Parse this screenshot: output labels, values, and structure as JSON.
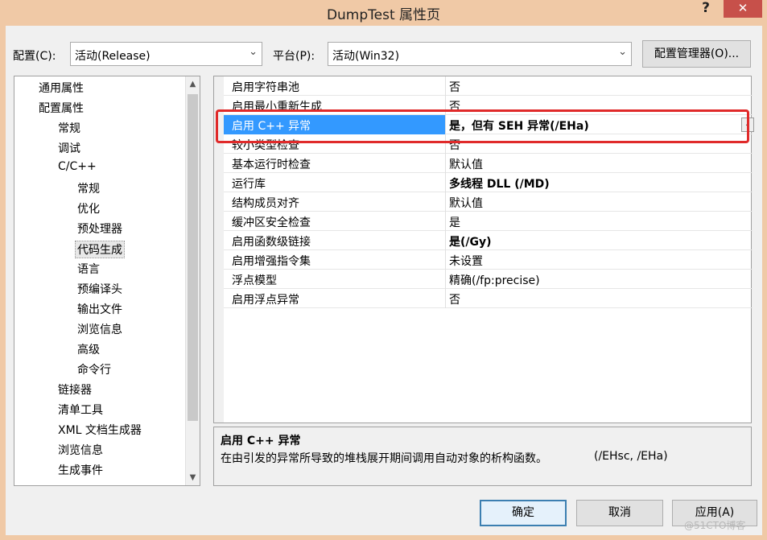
{
  "window": {
    "title": "DumpTest 属性页",
    "help": "?",
    "close": "✕"
  },
  "toolbar": {
    "config_label": "配置(C):",
    "config_value": "活动(Release)",
    "platform_label": "平台(P):",
    "platform_value": "活动(Win32)",
    "config_manager": "配置管理器(O)..."
  },
  "tree": {
    "items": [
      {
        "label": "通用属性",
        "level": 0
      },
      {
        "label": "配置属性",
        "level": 0
      },
      {
        "label": "常规",
        "level": 1
      },
      {
        "label": "调试",
        "level": 1
      },
      {
        "label": "C/C++",
        "level": 1
      },
      {
        "label": "常规",
        "level": 2
      },
      {
        "label": "优化",
        "level": 2
      },
      {
        "label": "预处理器",
        "level": 2
      },
      {
        "label": "代码生成",
        "level": 2,
        "selected": true
      },
      {
        "label": "语言",
        "level": 2
      },
      {
        "label": "预编译头",
        "level": 2
      },
      {
        "label": "输出文件",
        "level": 2
      },
      {
        "label": "浏览信息",
        "level": 2
      },
      {
        "label": "高级",
        "level": 2
      },
      {
        "label": "命令行",
        "level": 2
      },
      {
        "label": "链接器",
        "level": 1
      },
      {
        "label": "清单工具",
        "level": 1
      },
      {
        "label": "XML 文档生成器",
        "level": 1
      },
      {
        "label": "浏览信息",
        "level": 1
      },
      {
        "label": "生成事件",
        "level": 1
      }
    ]
  },
  "grid": {
    "rows": [
      {
        "name": "启用字符串池",
        "value": "否"
      },
      {
        "name": "启用最小重新生成",
        "value": "否"
      },
      {
        "name": "启用 C++ 异常",
        "value": "是，但有 SEH 异常(/EHa)",
        "selected": true
      },
      {
        "name": "较小类型检查",
        "value": "否"
      },
      {
        "name": "基本运行时检查",
        "value": "默认值"
      },
      {
        "name": "运行库",
        "value": "多线程 DLL (/MD)",
        "bold": true
      },
      {
        "name": "结构成员对齐",
        "value": "默认值"
      },
      {
        "name": "缓冲区安全检查",
        "value": "是"
      },
      {
        "name": "启用函数级链接",
        "value": "是(/Gy)",
        "bold": true
      },
      {
        "name": "启用增强指令集",
        "value": "未设置"
      },
      {
        "name": "浮点模型",
        "value": "精确(/fp:precise)"
      },
      {
        "name": "启用浮点异常",
        "value": "否"
      }
    ]
  },
  "description": {
    "title": "启用 C++ 异常",
    "text": "在由引发的异常所导致的堆栈展开期间调用自动对象的析构函数。",
    "switches": "(/EHsc, /EHa)"
  },
  "buttons": {
    "ok": "确定",
    "cancel": "取消",
    "apply": "应用(A)"
  },
  "watermark": "@51CTO博客",
  "colors": {
    "selection": "#3399ff",
    "highlight_box": "#e02a2a",
    "close_button": "#c7504a",
    "titlebar": "#f0c9a6"
  }
}
